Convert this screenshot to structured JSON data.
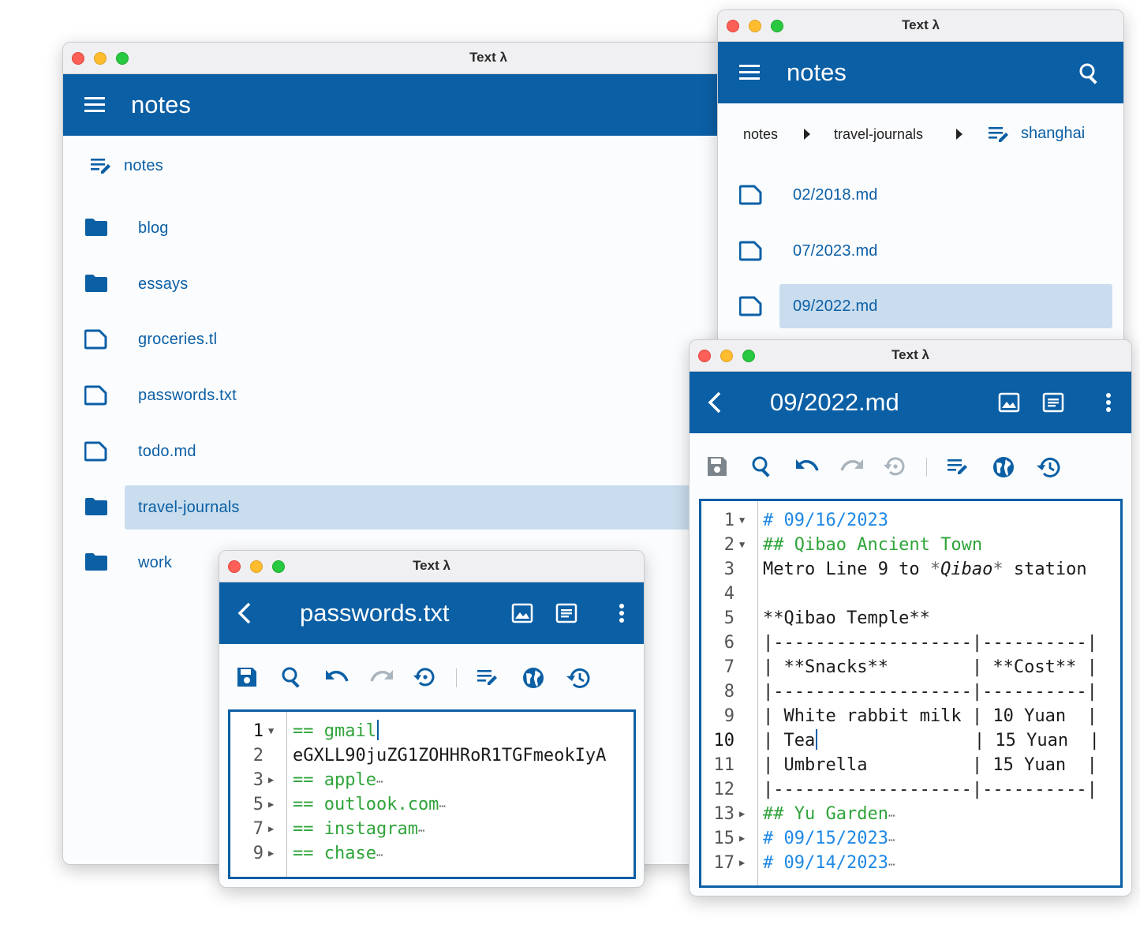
{
  "colors": {
    "primary": "#0b5fa5",
    "selection": "#c9ddee",
    "heading1": "#1e88e5",
    "heading2": "#2fa43a"
  },
  "browser_main": {
    "window_title": "Text λ",
    "appbar_title": "notes",
    "current_folder": "notes",
    "items": [
      {
        "label": "blog",
        "icon": "folder-icon"
      },
      {
        "label": "essays",
        "icon": "folder-icon"
      },
      {
        "label": "groceries.tl",
        "icon": "file-icon"
      },
      {
        "label": "passwords.txt",
        "icon": "file-icon"
      },
      {
        "label": "todo.md",
        "icon": "file-icon"
      },
      {
        "label": "travel-journals",
        "icon": "folder-icon",
        "selected": true
      },
      {
        "label": "work",
        "icon": "folder-icon"
      }
    ]
  },
  "browser_right": {
    "window_title": "Text λ",
    "appbar_title": "notes",
    "breadcrumb": [
      "notes",
      "travel-journals",
      "shanghai"
    ],
    "items": [
      {
        "label": "02/2018.md",
        "icon": "file-icon"
      },
      {
        "label": "07/2023.md",
        "icon": "file-icon"
      },
      {
        "label": "09/2022.md",
        "icon": "file-icon",
        "selected": true
      }
    ]
  },
  "passwords_editor": {
    "window_title": "Text λ",
    "file_name": "passwords.txt",
    "lines": [
      {
        "num": "1",
        "fold": "▼",
        "text": "== gmail",
        "style": "green",
        "current": true,
        "caret": true
      },
      {
        "num": "2",
        "fold": "",
        "text": "eGXLL90juZG1ZOHHRoR1TGFmeokIyA",
        "style": "plain"
      },
      {
        "num": "3",
        "fold": "▶",
        "text": "== apple",
        "style": "green",
        "ellipsis": "⋯"
      },
      {
        "num": "5",
        "fold": "▶",
        "text": "== outlook.com",
        "style": "green",
        "ellipsis": "⋯"
      },
      {
        "num": "7",
        "fold": "▶",
        "text": "== instagram",
        "style": "green",
        "ellipsis": "⋯"
      },
      {
        "num": "9",
        "fold": "▶",
        "text": "== chase",
        "style": "green",
        "ellipsis": "⋯"
      }
    ]
  },
  "journal_editor": {
    "window_title": "Text λ",
    "file_name": "09/2022.md",
    "lines": [
      {
        "num": "1",
        "fold": "▼",
        "text": "# 09/16/2023",
        "style": "h1"
      },
      {
        "num": "2",
        "fold": "▼",
        "text": "## Qibao Ancient Town",
        "style": "h2"
      },
      {
        "num": "3",
        "fold": "",
        "text": "Metro Line 9 to ",
        "style": "plain",
        "em_mark": "*",
        "em_text": "Qibao",
        "tail": " station"
      },
      {
        "num": "4",
        "fold": "",
        "text": "",
        "style": "plain"
      },
      {
        "num": "5",
        "fold": "",
        "text": "**Qibao Temple**",
        "style": "plain"
      },
      {
        "num": "6",
        "fold": "",
        "text": "|-------------------|----------|",
        "style": "plain"
      },
      {
        "num": "7",
        "fold": "",
        "text": "| **Snacks**        | **Cost** |",
        "style": "plain"
      },
      {
        "num": "8",
        "fold": "",
        "text": "|-------------------|----------|",
        "style": "plain"
      },
      {
        "num": "9",
        "fold": "",
        "text": "| White rabbit milk | 10 Yuan  |",
        "style": "plain"
      },
      {
        "num": "10",
        "fold": "",
        "text": "| Tea",
        "tail": "               | 15 Yuan  |",
        "style": "plain",
        "current": true,
        "caret": true
      },
      {
        "num": "11",
        "fold": "",
        "text": "| Umbrella          | 15 Yuan  |",
        "style": "plain"
      },
      {
        "num": "12",
        "fold": "",
        "text": "|-------------------|----------|",
        "style": "plain"
      },
      {
        "num": "13",
        "fold": "▶",
        "text": "## Yu Garden",
        "style": "h2",
        "ellipsis": "⋯"
      },
      {
        "num": "15",
        "fold": "▶",
        "text": "# 09/15/2023",
        "style": "h1",
        "ellipsis": "⋯"
      },
      {
        "num": "17",
        "fold": "▶",
        "text": "# 09/14/2023",
        "style": "h1",
        "ellipsis": "⋯"
      }
    ]
  }
}
